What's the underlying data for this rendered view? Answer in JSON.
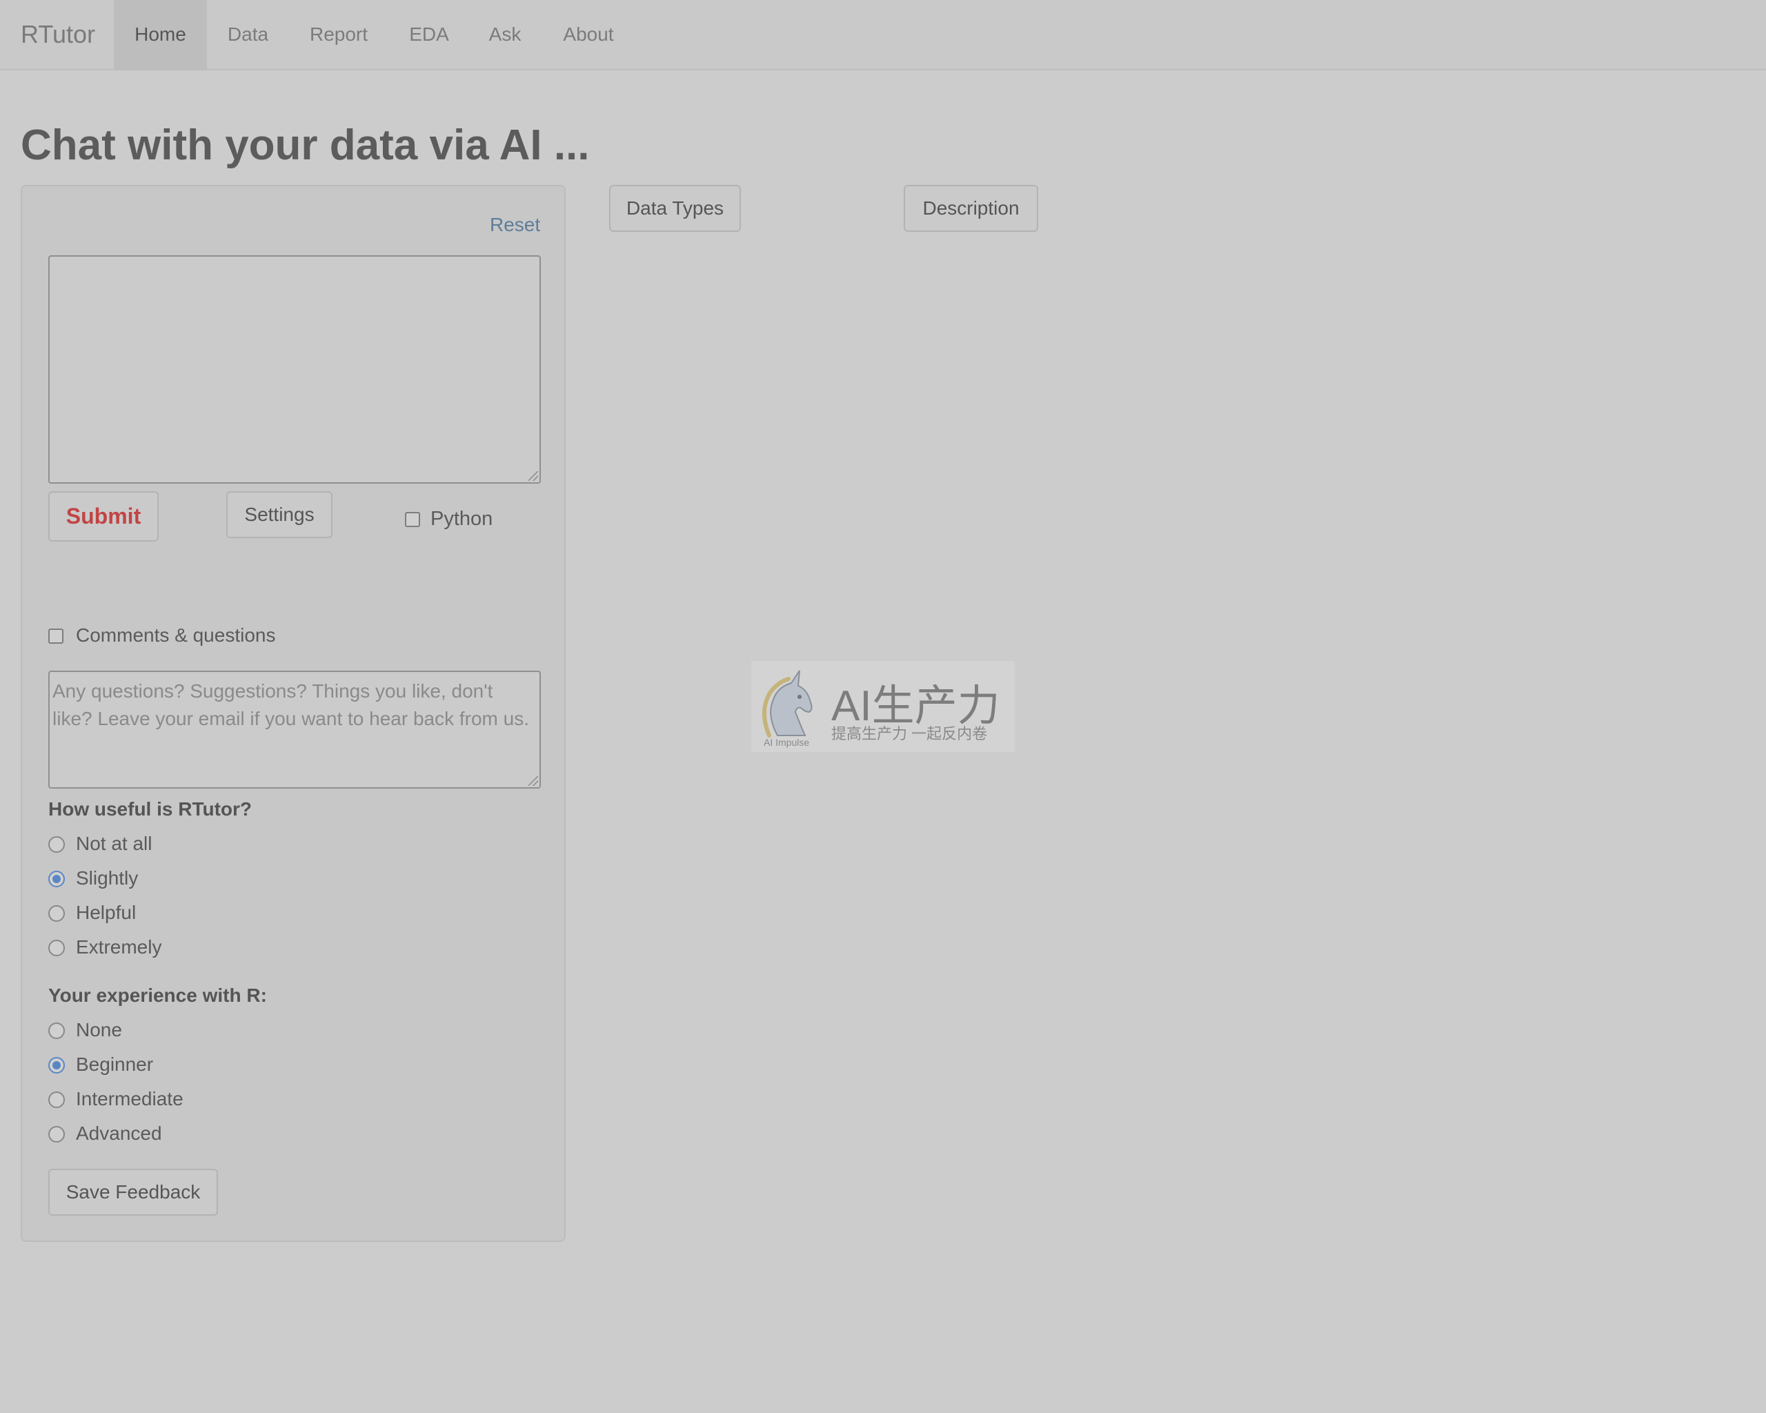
{
  "nav": {
    "brand": "RTutor",
    "items": [
      {
        "label": "Home",
        "active": true
      },
      {
        "label": "Data"
      },
      {
        "label": "Report"
      },
      {
        "label": "EDA"
      },
      {
        "label": "Ask"
      },
      {
        "label": "About"
      }
    ]
  },
  "page": {
    "title": "Chat with your data via AI ..."
  },
  "sidebar": {
    "reset_label": "Reset",
    "prompt_value": "",
    "submit_label": "Submit",
    "settings_label": "Settings",
    "python_label": "Python",
    "python_checked": false,
    "comments_label": "Comments & questions",
    "comments_checked": false,
    "comments_placeholder": "Any questions? Suggestions? Things you like, don't like? Leave your email if you want to hear back from us.",
    "usefulness": {
      "question": "How useful is RTutor?",
      "options": [
        "Not at all",
        "Slightly",
        "Helpful",
        "Extremely"
      ],
      "selected": "Slightly"
    },
    "experience": {
      "question": "Your experience with R:",
      "options": [
        "None",
        "Beginner",
        "Intermediate",
        "Advanced"
      ],
      "selected": "Beginner"
    },
    "save_feedback_label": "Save Feedback"
  },
  "main": {
    "data_types_label": "Data Types",
    "description_label": "Description"
  },
  "watermark": {
    "title": "AI生产力",
    "subtitle": "提高生产力 一起反内卷",
    "logo_caption": "AI Impulse"
  },
  "colors": {
    "background": "#cccccc",
    "accent": "#5a86c4",
    "submit": "#c24444",
    "link": "#5e7d9a"
  }
}
